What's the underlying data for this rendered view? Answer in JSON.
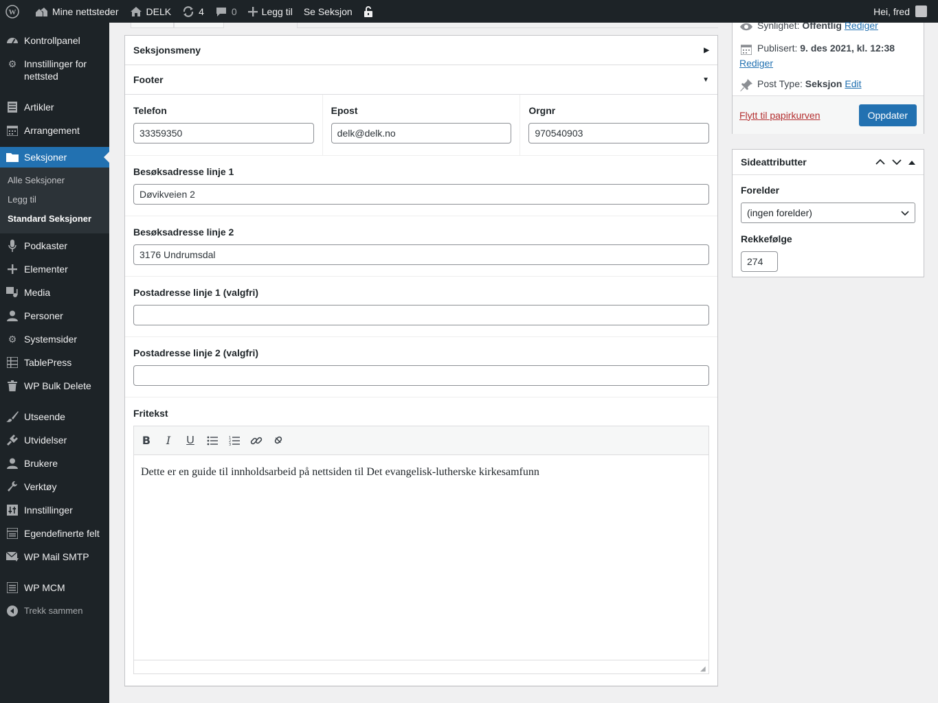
{
  "adminbar": {
    "my_sites": "Mine nettsteder",
    "site_name": "DELK",
    "updates_count": "4",
    "comments_count": "0",
    "add_new": "Legg til",
    "view": "Se Seksjon",
    "greeting": "Hei, fred"
  },
  "sidebar": {
    "items": [
      {
        "label": "Kontrollpanel",
        "icon": "dashboard-icon"
      },
      {
        "label": "Innstillinger for nettsted",
        "icon": "gear-icon"
      },
      {
        "label": "Artikler",
        "icon": "posts-icon"
      },
      {
        "label": "Arrangement",
        "icon": "calendar-icon"
      },
      {
        "label": "Seksjoner",
        "icon": "folder-icon"
      },
      {
        "label": "Podkaster",
        "icon": "microphone-icon"
      },
      {
        "label": "Elementer",
        "icon": "plus-icon"
      },
      {
        "label": "Media",
        "icon": "media-icon"
      },
      {
        "label": "Personer",
        "icon": "person-icon"
      },
      {
        "label": "Systemsider",
        "icon": "gear-icon"
      },
      {
        "label": "TablePress",
        "icon": "table-icon"
      },
      {
        "label": "WP Bulk Delete",
        "icon": "trash-icon"
      },
      {
        "label": "Utseende",
        "icon": "brush-icon"
      },
      {
        "label": "Utvidelser",
        "icon": "plugin-icon"
      },
      {
        "label": "Brukere",
        "icon": "user-icon"
      },
      {
        "label": "Verktøy",
        "icon": "wrench-icon"
      },
      {
        "label": "Innstillinger",
        "icon": "settings-icon"
      },
      {
        "label": "Egendefinerte felt",
        "icon": "fields-icon"
      },
      {
        "label": "WP Mail SMTP",
        "icon": "mail-icon"
      },
      {
        "label": "WP MCM",
        "icon": "list-icon"
      },
      {
        "label": "Trekk sammen",
        "icon": "collapse-icon"
      }
    ],
    "submenu": [
      "Alle Seksjoner",
      "Legg til",
      "Standard Seksjoner"
    ]
  },
  "main": {
    "section_menu": "Seksjonsmeny",
    "footer": "Footer",
    "fields": {
      "telefon_label": "Telefon",
      "telefon_value": "33359350",
      "epost_label": "Epost",
      "epost_value": "delk@delk.no",
      "orgnr_label": "Orgnr",
      "orgnr_value": "970540903",
      "besok1_label": "Besøksadresse linje 1",
      "besok1_value": "Døvikveien 2",
      "besok2_label": "Besøksadresse linje 2",
      "besok2_value": "3176 Undrumsdal",
      "post1_label": "Postadresse linje 1 (valgfri)",
      "post1_value": "",
      "post2_label": "Postadresse linje 2 (valgfri)",
      "post2_value": "",
      "fritekst_label": "Fritekst",
      "fritekst_value": "Dette er en guide til innholdsarbeid på nettsiden til Det evangelisk-lutherske kirkesamfunn"
    }
  },
  "publish": {
    "visibility_label": "Synlighet:",
    "visibility_value": "Offentlig",
    "visibility_edit": "Rediger",
    "published_label": "Publisert:",
    "published_value": "9. des 2021, kl. 12:38",
    "published_edit": "Rediger",
    "post_type_label": "Post Type:",
    "post_type_value": "Seksjon",
    "post_type_edit": "Edit",
    "trash": "Flytt til papirkurven",
    "update": "Oppdater"
  },
  "attributes": {
    "title": "Sideattributter",
    "parent_label": "Forelder",
    "parent_value": "(ingen forelder)",
    "order_label": "Rekkefølge",
    "order_value": "274"
  }
}
